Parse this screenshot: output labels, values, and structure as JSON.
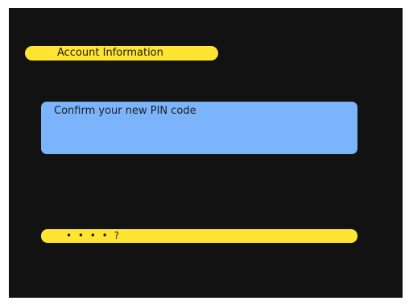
{
  "header": {
    "title": "Account Information"
  },
  "prompt": {
    "text": "Confirm your new PIN code"
  },
  "pin_entry": {
    "value": "• • • • ?"
  },
  "colors": {
    "background": "#121212",
    "accent_yellow": "#ffe531",
    "prompt_blue": "#7cb4fb"
  }
}
